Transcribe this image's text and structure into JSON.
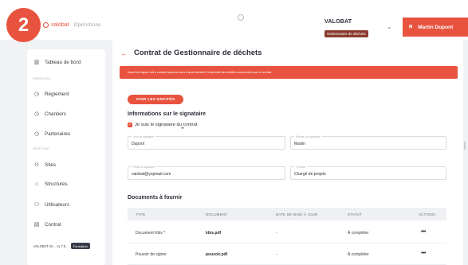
{
  "step_badge": "2",
  "brand": {
    "name": "valobat",
    "sub": "Opérations"
  },
  "org": {
    "name": "VALOBAT",
    "role": "Gestionnaire de déchets"
  },
  "user": {
    "name": "Martin Dupont"
  },
  "sidebar": {
    "items": [
      {
        "label": "Tableau de bord",
        "icon": "building-icon"
      },
      {
        "label": "Règlement",
        "icon": "clock-icon"
      },
      {
        "label": "Chantiers",
        "icon": "clock-icon"
      },
      {
        "label": "Partenaires",
        "icon": "clock-icon"
      },
      {
        "label": "Sites",
        "icon": "pin-icon"
      },
      {
        "label": "Structures",
        "icon": "structure-icon"
      },
      {
        "label": "Utilisateurs",
        "icon": "users-icon"
      },
      {
        "label": "Contrat",
        "icon": "document-icon"
      }
    ],
    "sections": [
      "SERVICES",
      "GESTION"
    ],
    "footer": {
      "version": "VALOBAT Gr... v1.7.0...",
      "tag": "Formation"
    }
  },
  "page": {
    "title": "Contrat de Gestionnaire de déchets",
    "alert": "Avant de signer votre contrat assurez-vous d'avoir déclaré l'ensemble des entités concernées par le contrat",
    "see_entities": "VOIR LES ENTITÉS",
    "signatory_title": "Informations sur le signataire",
    "checkbox_label": "Je suis le signataire du contrat",
    "fields": [
      {
        "label": "Nom du signataire",
        "value": "Dupont"
      },
      {
        "label": "Prénom du signataire",
        "value": "Martin"
      },
      {
        "label": "Email du signataire",
        "value": "valobat@yopmail.com"
      },
      {
        "label": "Fonction",
        "value": "Chargé de projets"
      }
    ],
    "docs_title": "Documents à fournir",
    "table": {
      "headers": [
        "TYPE",
        "DOCUMENT",
        "DATE DE MISE À JOUR",
        "STATUT",
        "ACTIONS"
      ],
      "rows": [
        {
          "type": "Document Kbis *",
          "document": "kbis.pdf",
          "date": "-",
          "status": "À compléter",
          "action": "•••"
        },
        {
          "type": "Pouvoir de signer",
          "document": "pouvoir.pdf",
          "date": "-",
          "status": "À compléter",
          "action": "•••"
        }
      ]
    }
  },
  "colors": {
    "accent": "#e8533f",
    "role_badge": "#8b3b2e"
  }
}
